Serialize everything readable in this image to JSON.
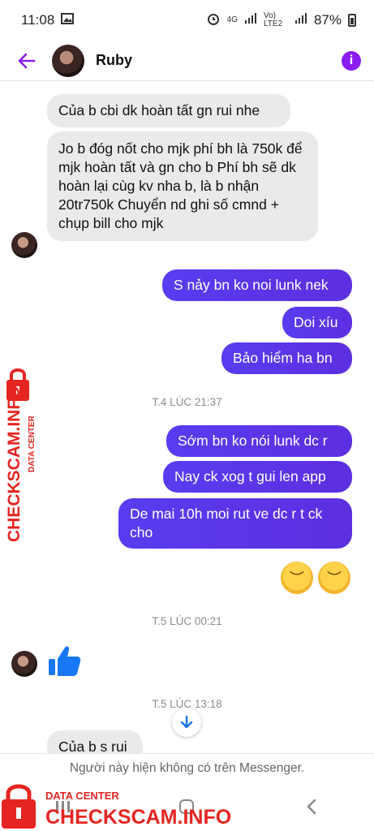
{
  "status": {
    "time": "11:08",
    "network": "4G",
    "volte": "Vo) LTE2",
    "battery": "87%"
  },
  "header": {
    "contact_name": "Ruby"
  },
  "messages": [
    {
      "dir": "in",
      "text": "Của b cbi dk hoàn tất gn rui nhe"
    },
    {
      "dir": "in",
      "text": "Jo b đóg nốt cho mjk phí bh là 750k để mjk hoàn tất và gn cho b Phí bh sẽ dk hoàn lại cùg kv nha b, là b nhận 20tr750k Chuyển nd ghi số cmnd + chụp bill cho mjk"
    },
    {
      "dir": "out",
      "text": "S nảy bn ko noi lunk nek"
    },
    {
      "dir": "out",
      "text": "Doi xíu"
    },
    {
      "dir": "out",
      "text": "Bảo hiểm ha bn"
    },
    {
      "dir": "stamp",
      "text": "T.4 LÚC 21:37"
    },
    {
      "dir": "out",
      "text": "Sớm bn ko nói lunk dc r"
    },
    {
      "dir": "out",
      "text": "Nay ck xog t gui len app"
    },
    {
      "dir": "out",
      "text": "De mai 10h moi rut ve dc r t ck cho"
    },
    {
      "dir": "stamp",
      "text": "T.5 LÚC 00:21"
    },
    {
      "dir": "stamp",
      "text": "T.5 LÚC 13:18"
    },
    {
      "dir": "in",
      "text": "Của b s rui"
    }
  ],
  "footer": {
    "notice": "Người này hiện không có trên Messenger."
  },
  "watermark": {
    "title": "DATA CENTER",
    "brand": "CHECKSCAM.INFO"
  },
  "icons": {
    "back": "back-arrow-icon",
    "info": "info-icon",
    "scroll": "arrow-down-icon",
    "like": "thumbs-up-icon",
    "emoji": "disappointed-face-icon"
  },
  "colors": {
    "accent": "#8a1cf0",
    "outgoing": "#5a3cf0",
    "incoming": "#eaeaea",
    "watermark": "#e52521"
  }
}
